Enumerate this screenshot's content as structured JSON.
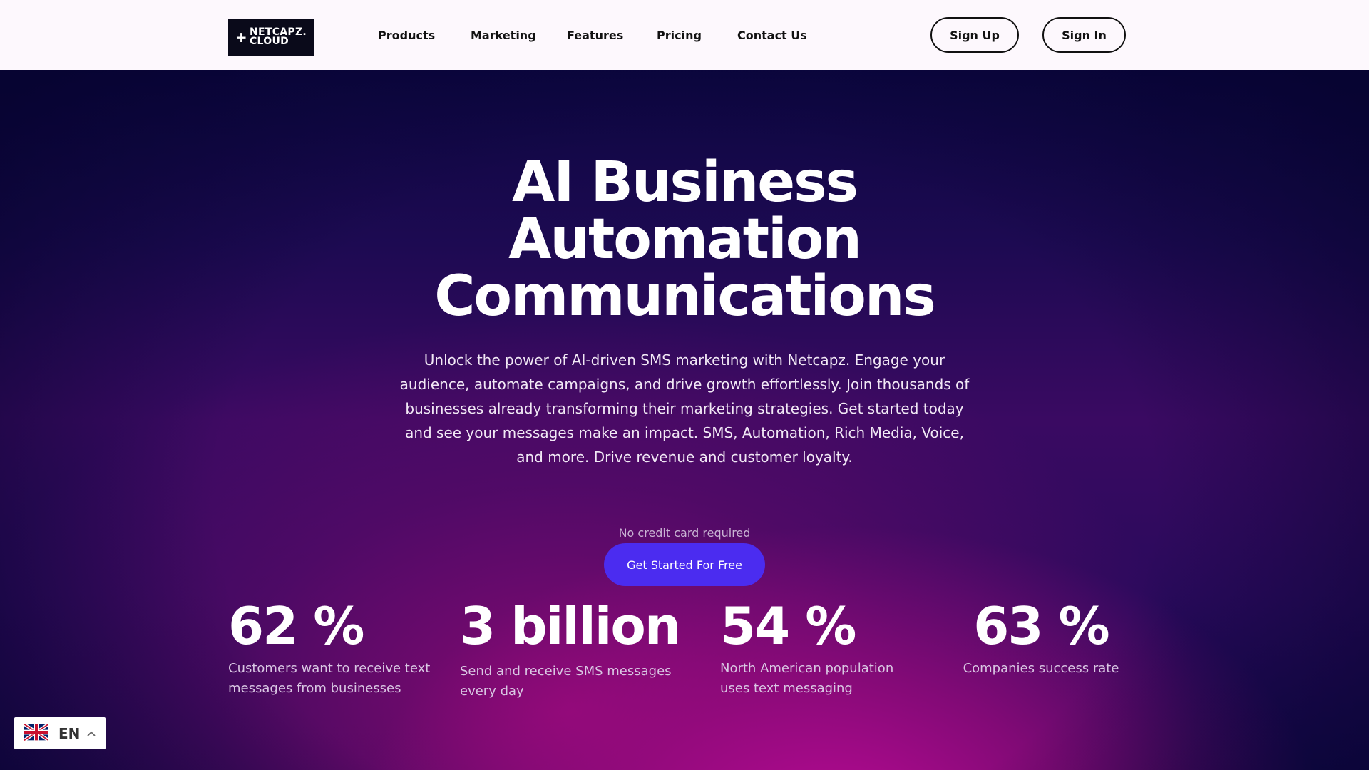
{
  "header": {
    "logo": {
      "line1": "NETCAPZ.",
      "line2": "CLOUD",
      "symbol": "+"
    },
    "nav": [
      "Products",
      "Marketing",
      "Features",
      "Pricing",
      "Contact Us"
    ],
    "signup_label": "Sign Up",
    "signin_label": "Sign In"
  },
  "hero": {
    "title_lines": [
      "AI Business",
      "Automation",
      "Communications"
    ],
    "subtitle": "Unlock the power of AI-driven SMS marketing with Netcapz. Engage your audience, automate campaigns, and drive growth effortlessly. Join thousands of businesses already transforming their marketing strategies. Get started today and see your messages make an impact. SMS, Automation, Rich Media, Voice, and more. Drive revenue and customer loyalty.",
    "note": "No credit card required",
    "cta_label": "Get Started For Free"
  },
  "stats": [
    {
      "value": "62 %",
      "desc": "Customers want to receive text messages from businesses"
    },
    {
      "value": "3 billion",
      "desc": "Send and receive SMS messages every day"
    },
    {
      "value": "54 %",
      "desc": "North American population uses text messaging"
    },
    {
      "value": "63 %",
      "desc": "Companies success rate"
    }
  ],
  "language": {
    "code": "EN",
    "flag_icon": "uk-flag-icon",
    "chevron_icon": "chevron-up-icon"
  },
  "colors": {
    "cta": "#4b2cf0",
    "hero_dark": "#0c0640",
    "hero_magenta": "#be0a96"
  }
}
